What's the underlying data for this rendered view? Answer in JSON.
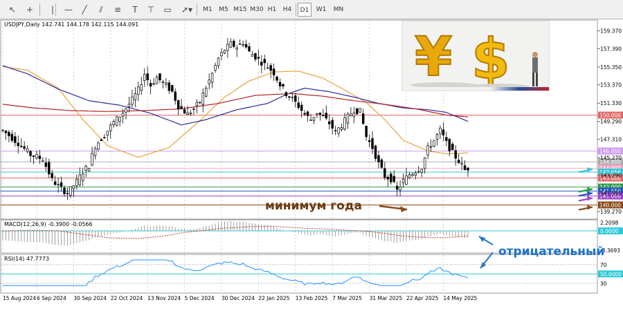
{
  "toolbar": {
    "timeframes": [
      "M1",
      "M5",
      "M15",
      "M30",
      "H1",
      "H4",
      "D1",
      "W1",
      "MN"
    ],
    "active_timeframe": "D1",
    "tools": [
      "cursor-icon",
      "crosshair-icon",
      "vertical-line-icon",
      "horizontal-line-icon",
      "trendline-icon",
      "channel-icon",
      "fibonacci-icon",
      "text-icon",
      "label-icon",
      "shapes-icon",
      "arrow-tools-icon"
    ],
    "tool_glyphs": [
      "↖",
      "+",
      "|",
      "—",
      "╱",
      "⫽",
      "≡",
      "T",
      "⊤",
      "▭",
      "➚▾"
    ]
  },
  "header": {
    "symbol_info": "USDJPY,Daily  142.741 144.178 142.115 144.091"
  },
  "chart_data": [
    {
      "type": "candlestick",
      "symbol": "USDJPY",
      "timeframe": "Daily",
      "ohlc_last": {
        "open": 142.741,
        "high": 144.178,
        "low": 142.115,
        "close": 144.091
      },
      "ylim": [
        138.5,
        160.5
      ],
      "y_ticks": [
        "159.370",
        "157.390",
        "155.350",
        "153.370",
        "151.330",
        "149.290",
        "147.310",
        "145.270",
        "143.290",
        "141.310",
        "139.270"
      ],
      "x_ticks": [
        "15 Aug 2024",
        "6 Sep 2024",
        "30 Sep 2024",
        "22 Oct 2024",
        "13 Nov 2024",
        "5 Dec 2024",
        "30 Dec 2024",
        "22 Jan 2025",
        "13 Feb 2025",
        "7 Mar 2025",
        "31 Mar 2025",
        "22 Apr 2025",
        "14 May 2025"
      ],
      "price_path": [
        [
          0,
          148.3
        ],
        [
          5,
          146.9
        ],
        [
          9,
          145.6
        ],
        [
          13,
          145.1
        ],
        [
          16,
          142.8
        ],
        [
          18,
          142.1
        ],
        [
          21,
          141.3
        ],
        [
          24,
          142.6
        ],
        [
          26,
          143.7
        ],
        [
          28,
          144.4
        ],
        [
          30,
          146.6
        ],
        [
          33,
          147.8
        ],
        [
          36,
          149.2
        ],
        [
          39,
          150.3
        ],
        [
          42,
          151.7
        ],
        [
          44,
          152.8
        ],
        [
          46,
          154.6
        ],
        [
          48,
          153.3
        ],
        [
          50,
          154.2
        ],
        [
          53,
          153.3
        ],
        [
          55,
          152.6
        ],
        [
          57,
          151.0
        ],
        [
          60,
          150.1
        ],
        [
          62,
          150.7
        ],
        [
          64,
          151.5
        ],
        [
          66,
          153.1
        ],
        [
          68,
          154.6
        ],
        [
          70,
          156.3
        ],
        [
          72,
          157.3
        ],
        [
          74,
          157.9
        ],
        [
          76,
          157.6
        ],
        [
          78,
          158.1
        ],
        [
          80,
          157.0
        ],
        [
          82,
          156.5
        ],
        [
          84,
          155.9
        ],
        [
          86,
          155.4
        ],
        [
          88,
          154.7
        ],
        [
          90,
          153.4
        ],
        [
          92,
          152.4
        ],
        [
          94,
          151.8
        ],
        [
          96,
          151.0
        ],
        [
          98,
          150.1
        ],
        [
          100,
          149.5
        ],
        [
          102,
          150.3
        ],
        [
          104,
          149.8
        ],
        [
          106,
          149.1
        ],
        [
          108,
          148.1
        ],
        [
          110,
          148.9
        ],
        [
          112,
          149.8
        ],
        [
          114,
          150.6
        ],
        [
          116,
          150.4
        ],
        [
          118,
          147.6
        ],
        [
          120,
          146.4
        ],
        [
          122,
          144.6
        ],
        [
          124,
          143.2
        ],
        [
          126,
          142.9
        ],
        [
          128,
          141.6
        ],
        [
          130,
          142.7
        ],
        [
          132,
          143.4
        ],
        [
          134,
          143.8
        ],
        [
          136,
          144.2
        ],
        [
          138,
          146.3
        ],
        [
          140,
          147.2
        ],
        [
          142,
          148.3
        ],
        [
          144,
          146.9
        ],
        [
          146,
          145.8
        ],
        [
          148,
          144.9
        ],
        [
          150,
          143.9
        ],
        [
          151,
          144.1
        ]
      ],
      "ma_fast": [
        [
          0,
          155.4
        ],
        [
          8,
          155.0
        ],
        [
          18,
          153.0
        ],
        [
          26,
          149.5
        ],
        [
          34,
          146.6
        ],
        [
          44,
          145.3
        ],
        [
          54,
          146.4
        ],
        [
          64,
          149.4
        ],
        [
          72,
          152.0
        ],
        [
          80,
          153.8
        ],
        [
          88,
          154.8
        ],
        [
          96,
          154.9
        ],
        [
          104,
          154.1
        ],
        [
          112,
          152.6
        ],
        [
          118,
          151.4
        ],
        [
          124,
          149.5
        ],
        [
          130,
          147.2
        ],
        [
          138,
          146.0
        ],
        [
          144,
          145.7
        ],
        [
          151,
          145.8
        ]
      ],
      "ma_mid": [
        [
          0,
          155.5
        ],
        [
          8,
          154.6
        ],
        [
          18,
          152.9
        ],
        [
          28,
          151.6
        ],
        [
          38,
          151.1
        ],
        [
          48,
          150.2
        ],
        [
          58,
          148.9
        ],
        [
          66,
          149.5
        ],
        [
          76,
          150.6
        ],
        [
          86,
          151.3
        ],
        [
          92,
          152.3
        ],
        [
          98,
          153.0
        ],
        [
          106,
          152.6
        ],
        [
          114,
          152.0
        ],
        [
          122,
          151.3
        ],
        [
          130,
          150.8
        ],
        [
          138,
          150.6
        ],
        [
          144,
          150.3
        ],
        [
          151,
          149.3
        ]
      ],
      "ma_slow": [
        [
          0,
          151.2
        ],
        [
          10,
          150.8
        ],
        [
          22,
          150.5
        ],
        [
          34,
          150.4
        ],
        [
          46,
          150.5
        ],
        [
          58,
          150.7
        ],
        [
          70,
          151.3
        ],
        [
          82,
          152.2
        ],
        [
          94,
          152.4
        ],
        [
          104,
          152.1
        ],
        [
          114,
          151.6
        ],
        [
          124,
          151.2
        ],
        [
          134,
          150.7
        ],
        [
          144,
          150.0
        ],
        [
          151,
          149.8
        ]
      ],
      "levels": [
        {
          "label": "150.000",
          "value": 150.0,
          "color": "#e06666"
        },
        {
          "label": "146.000",
          "value": 146.0,
          "color": "#cc99ee"
        },
        {
          "label": "144.800",
          "value": 144.8,
          "color": "#aaaaaa"
        },
        {
          "label": "144.091",
          "value": 144.091,
          "color": "#f4a6c6"
        },
        {
          "label": "143.656",
          "value": 143.656,
          "color": "#2ec9d6"
        },
        {
          "label": "143.000",
          "value": 143.0,
          "color": "#e06666"
        },
        {
          "label": "142.000",
          "value": 142.0,
          "color": "#2e9e4a"
        },
        {
          "label": "141.550",
          "value": 141.55,
          "color": "#2255bb"
        },
        {
          "label": "141.000",
          "value": 141.0,
          "color": "#9944cc"
        },
        {
          "label": "140.000",
          "value": 140.0,
          "color": "#8b4a1a"
        }
      ],
      "annotation": "минимум года"
    },
    {
      "type": "histogram",
      "indicator_label": "MACD(12,26,9) -0.3900 -0.0566",
      "y_ticks": [
        "2.2098",
        "0.0000",
        "-3.3693"
      ],
      "note": "signal-line"
    },
    {
      "type": "line",
      "indicator_label": "RSI(14) 47.7773",
      "y_ticks": [
        "70",
        "50.0000",
        "30"
      ],
      "levels": [
        70,
        50,
        30
      ]
    }
  ],
  "annotations": {
    "negative_label": "отрицательный"
  },
  "colors": {
    "candle": "#000000",
    "ma_fast": "#e8a23a",
    "ma_mid": "#2a2a9a",
    "ma_slow": "#b22222",
    "macd": "#888888",
    "macd_signal": "#c0392b",
    "rsi": "#1e90ff",
    "annotation_text": "#6b3a12",
    "negative_text": "#1e73c8"
  },
  "promo_image": {
    "symbols": [
      "¥",
      "$"
    ],
    "icon": "yen-dollar-currency-icon"
  }
}
